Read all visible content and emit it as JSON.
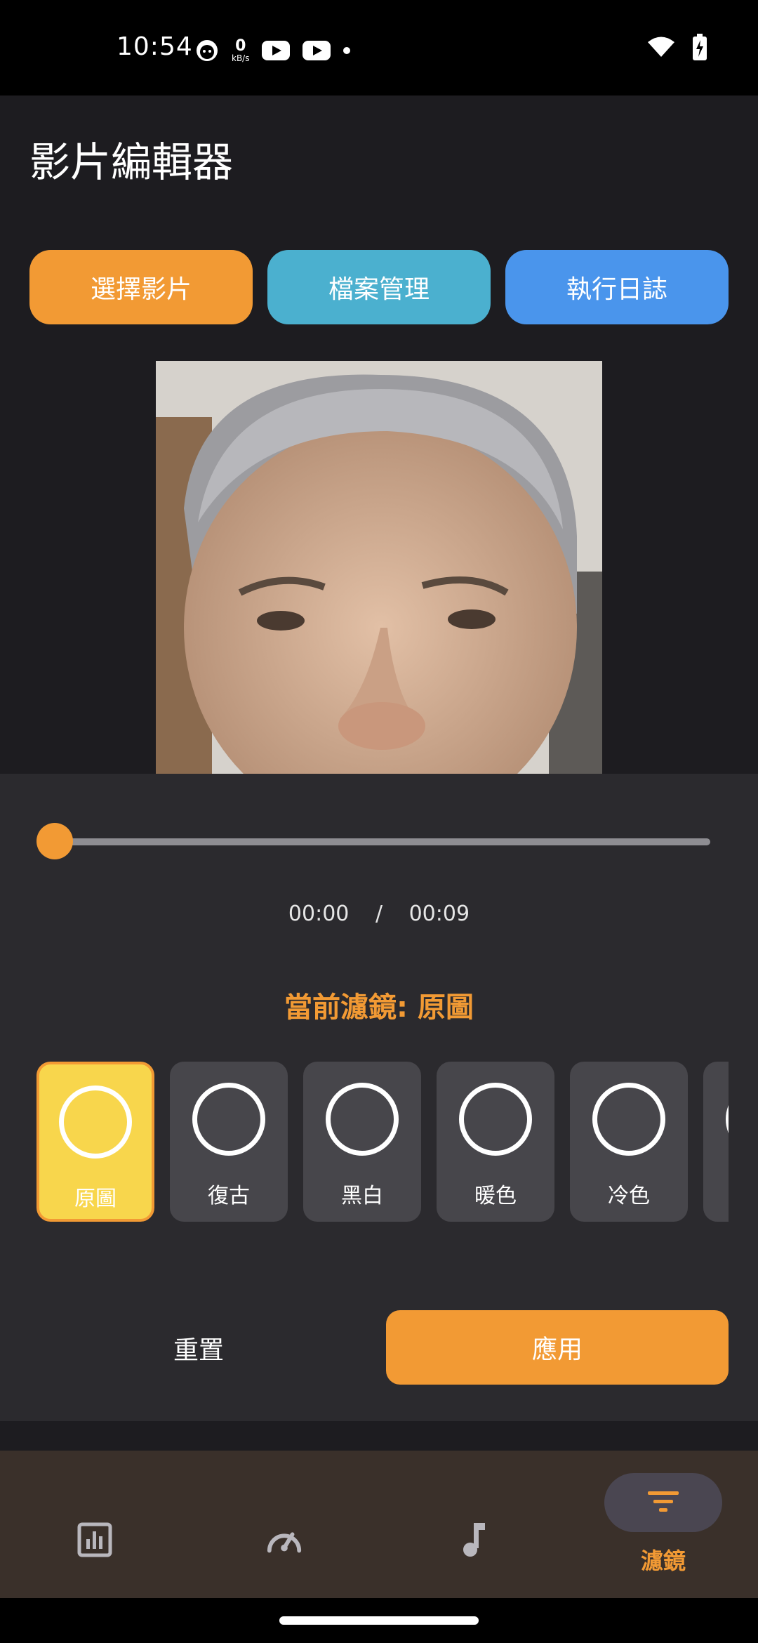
{
  "status_bar": {
    "time": "10:54",
    "net_speed_value": "0",
    "net_speed_unit": "kB/s"
  },
  "app": {
    "title": "影片編輯器"
  },
  "actions": {
    "select_video": "選擇影片",
    "file_manager": "檔案管理",
    "run_log": "執行日誌"
  },
  "player": {
    "progress": 0,
    "current_time": "00:00",
    "separator": "/",
    "duration": "00:09"
  },
  "filter_panel": {
    "current_label": "當前濾鏡: 原圖",
    "filters": [
      {
        "label": "原圖",
        "selected": true
      },
      {
        "label": "復古"
      },
      {
        "label": "黑白"
      },
      {
        "label": "暖色"
      },
      {
        "label": "冷色"
      }
    ],
    "reset_label": "重置",
    "apply_label": "應用"
  },
  "bottom_nav": {
    "items": [
      {
        "icon": "bar-chart-icon"
      },
      {
        "icon": "speedometer-icon"
      },
      {
        "icon": "music-note-icon"
      },
      {
        "icon": "filter-icon",
        "label": "濾鏡",
        "active": true
      }
    ]
  },
  "colors": {
    "accent": "#f29a34",
    "files_button": "#4bb0cf",
    "logs_button": "#4a95ec",
    "selected_filter": "#f8d64c"
  }
}
